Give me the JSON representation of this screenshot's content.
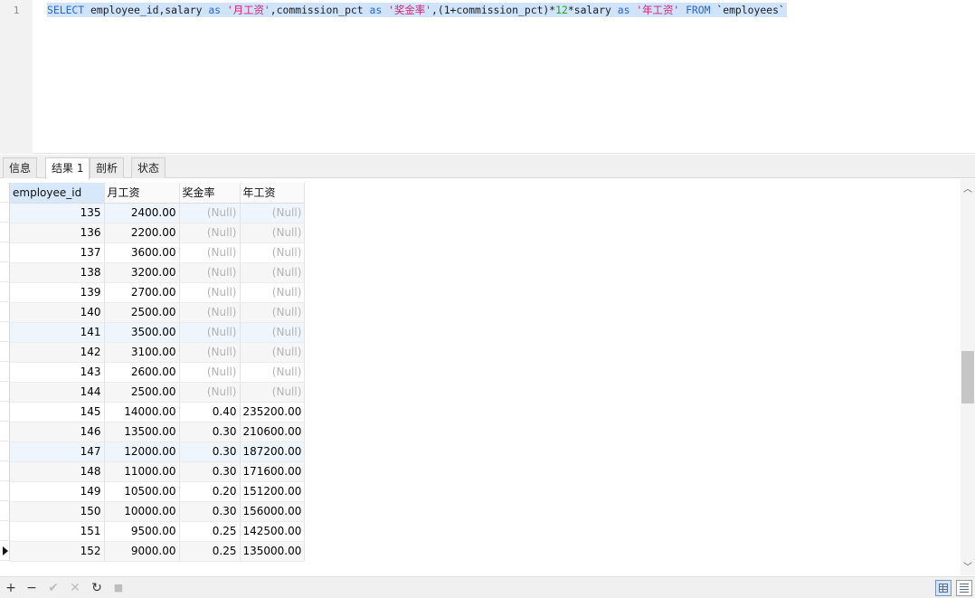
{
  "editor": {
    "line_number": "1",
    "tokens": [
      {
        "t": "SELECT",
        "c": "kw"
      },
      {
        "t": " employee_id,salary ",
        "c": "plain"
      },
      {
        "t": "as",
        "c": "kw"
      },
      {
        "t": " ",
        "c": "plain"
      },
      {
        "t": "'月工资'",
        "c": "str"
      },
      {
        "t": ",commission_pct ",
        "c": "plain"
      },
      {
        "t": "as",
        "c": "kw"
      },
      {
        "t": " ",
        "c": "plain"
      },
      {
        "t": "'奖金率'",
        "c": "str"
      },
      {
        "t": ",(1+commission_pct)*",
        "c": "plain"
      },
      {
        "t": "12",
        "c": "num"
      },
      {
        "t": "*salary ",
        "c": "plain"
      },
      {
        "t": "as",
        "c": "kw"
      },
      {
        "t": " ",
        "c": "plain"
      },
      {
        "t": "'年工资'",
        "c": "str"
      },
      {
        "t": " ",
        "c": "plain"
      },
      {
        "t": "FROM",
        "c": "kw"
      },
      {
        "t": " `employees`",
        "c": "plain"
      }
    ]
  },
  "tabs": [
    {
      "label": "信息",
      "active": false
    },
    {
      "label": "结果 1",
      "active": true
    },
    {
      "label": "剖析",
      "active": false
    },
    {
      "label": "状态",
      "active": false
    }
  ],
  "grid": {
    "columns": [
      "employee_id",
      "月工资",
      "奖金率",
      "年工资"
    ],
    "rows": [
      [
        "135",
        "2400.00",
        "(Null)",
        "(Null)"
      ],
      [
        "136",
        "2200.00",
        "(Null)",
        "(Null)"
      ],
      [
        "137",
        "3600.00",
        "(Null)",
        "(Null)"
      ],
      [
        "138",
        "3200.00",
        "(Null)",
        "(Null)"
      ],
      [
        "139",
        "2700.00",
        "(Null)",
        "(Null)"
      ],
      [
        "140",
        "2500.00",
        "(Null)",
        "(Null)"
      ],
      [
        "141",
        "3500.00",
        "(Null)",
        "(Null)"
      ],
      [
        "142",
        "3100.00",
        "(Null)",
        "(Null)"
      ],
      [
        "143",
        "2600.00",
        "(Null)",
        "(Null)"
      ],
      [
        "144",
        "2500.00",
        "(Null)",
        "(Null)"
      ],
      [
        "145",
        "14000.00",
        "0.40",
        "235200.00"
      ],
      [
        "146",
        "13500.00",
        "0.30",
        "210600.00"
      ],
      [
        "147",
        "12000.00",
        "0.30",
        "187200.00"
      ],
      [
        "148",
        "11000.00",
        "0.30",
        "171600.00"
      ],
      [
        "149",
        "10500.00",
        "0.20",
        "151200.00"
      ],
      [
        "150",
        "10000.00",
        "0.30",
        "156000.00"
      ],
      [
        "151",
        "9500.00",
        "0.25",
        "142500.00"
      ],
      [
        "152",
        "9000.00",
        "0.25",
        "135000.00"
      ]
    ],
    "current_row_index": 17,
    "highlighted_rows": [
      0,
      6,
      12
    ],
    "null_text": "(Null)"
  },
  "toolbar": {
    "add_icon": "+",
    "delete_icon": "−",
    "apply_icon": "✔",
    "discard_icon": "✕",
    "refresh_icon": "↻",
    "stop_icon": "■"
  },
  "colors": {
    "keyword": "#2a66d8",
    "string": "#e01a6a",
    "number": "#1fa52a",
    "selection": "#cfe4fb",
    "null_text": "#b4b4b4"
  }
}
